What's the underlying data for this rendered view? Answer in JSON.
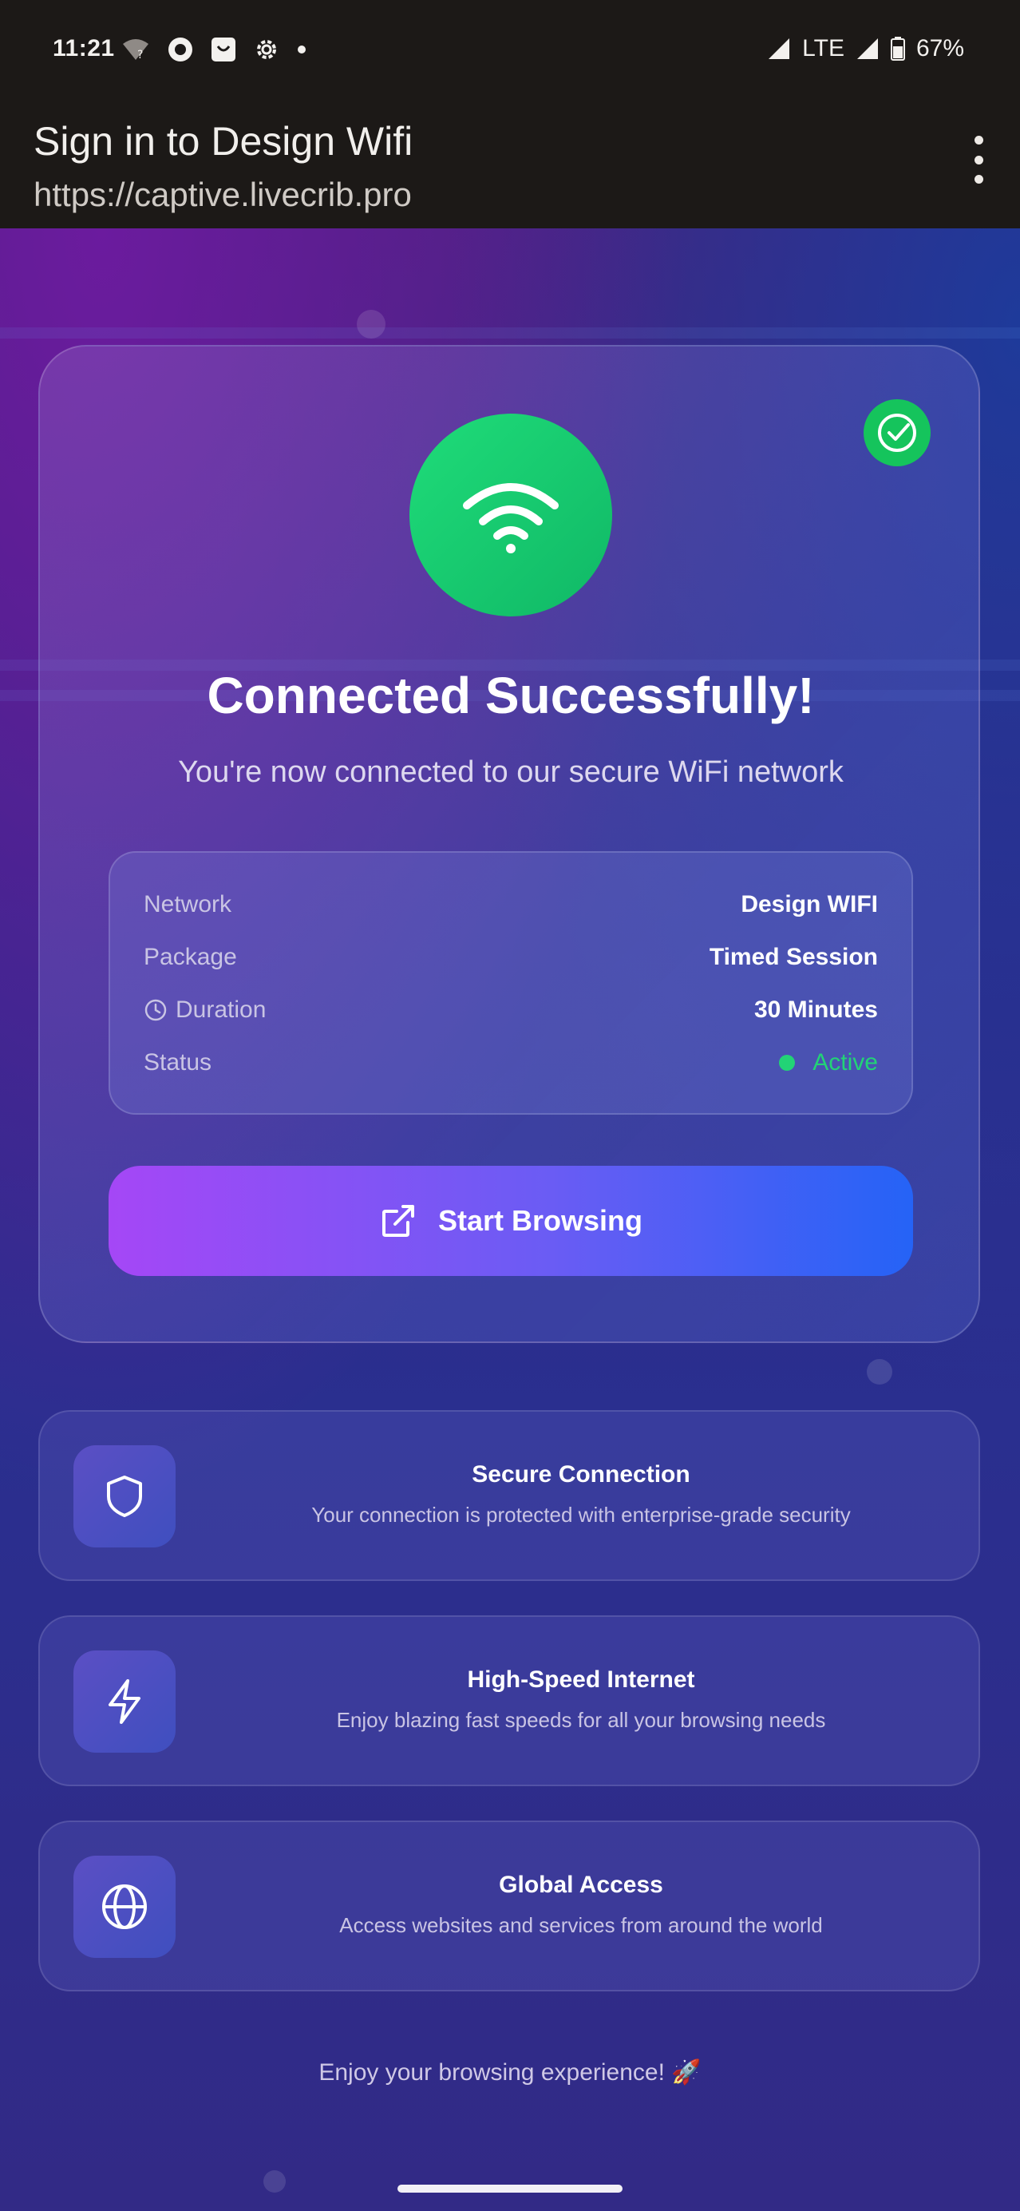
{
  "status_bar": {
    "time": "11:21",
    "network": "LTE",
    "battery": "67%",
    "icons": [
      "wifi-question-icon",
      "circle-o-icon",
      "shopping-bag-icon",
      "gear-icon",
      "dot-icon",
      "signal-icon",
      "battery-icon"
    ]
  },
  "app_bar": {
    "title": "Sign in to Design Wifi",
    "url": "https://captive.livecrib.pro"
  },
  "card": {
    "title": "Connected Successfully!",
    "subtitle": "You're now connected to our secure WiFi network",
    "rows": [
      {
        "label": "Network",
        "value": "Design WIFI"
      },
      {
        "label": "Package",
        "value": "Timed Session"
      },
      {
        "label": "Duration",
        "value": "30 Minutes"
      },
      {
        "label": "Status",
        "value": "Active"
      }
    ],
    "button_label": "Start Browsing"
  },
  "features": [
    {
      "title": "Secure Connection",
      "desc": "Your connection is protected with enterprise-grade security",
      "icon": "shield-icon"
    },
    {
      "title": "High-Speed Internet",
      "desc": "Enjoy blazing fast speeds for all your browsing needs",
      "icon": "lightning-icon"
    },
    {
      "title": "Global Access",
      "desc": "Access websites and services from around the world",
      "icon": "globe-icon"
    }
  ],
  "footer": "Enjoy your browsing experience! 🚀",
  "colors": {
    "success_green": "#22d376",
    "button_start": "#a547f6",
    "button_end": "#2563f6"
  }
}
